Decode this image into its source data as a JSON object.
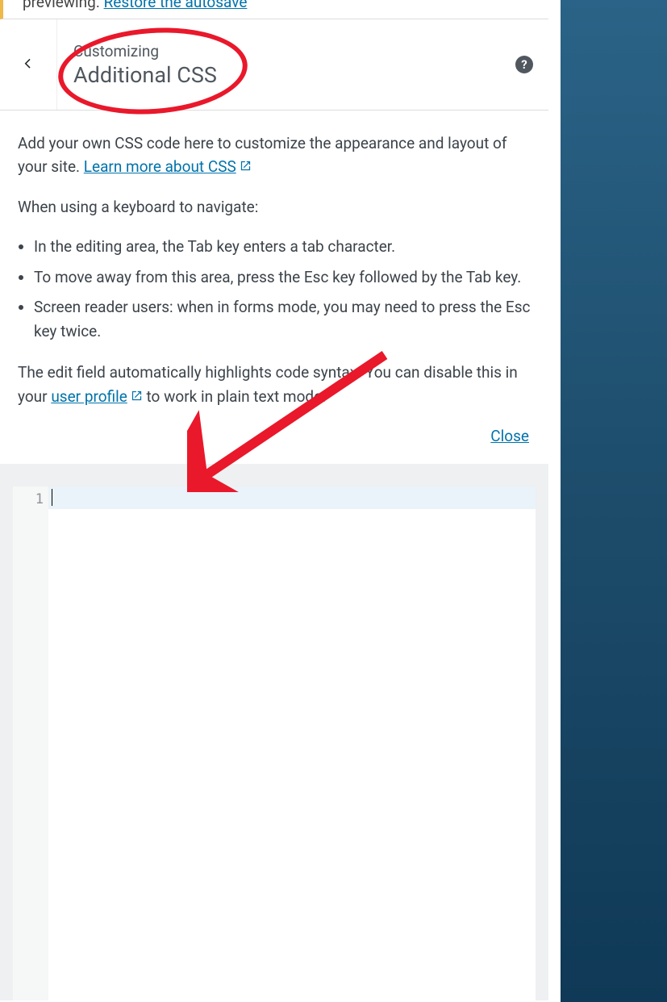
{
  "notice": {
    "prefix_fragment": "previewing.",
    "link": "Restore the autosave"
  },
  "header": {
    "eyebrow": "Customizing",
    "title": "Additional CSS"
  },
  "help": {
    "glyph": "?"
  },
  "intro": {
    "p1_prefix": "Add your own CSS code here to customize the appearance and layout of your site. ",
    "p1_link": "Learn more about CSS",
    "keyboard_heading": "When using a keyboard to navigate:",
    "bullets": [
      "In the editing area, the Tab key enters a tab character.",
      "To move away from this area, press the Esc key followed by the Tab key.",
      "Screen reader users: when in forms mode, you may need to press the Esc key twice."
    ],
    "syntax_prefix": "The edit field automatically highlights code syntax. You can disable this in your ",
    "syntax_link": "user profile",
    "syntax_suffix": " to work in plain text mode."
  },
  "close_link": "Close",
  "editor": {
    "gutter": "1",
    "content": ""
  },
  "annotations": {
    "circle_color": "#e9182b",
    "arrow_color": "#e9182b"
  }
}
